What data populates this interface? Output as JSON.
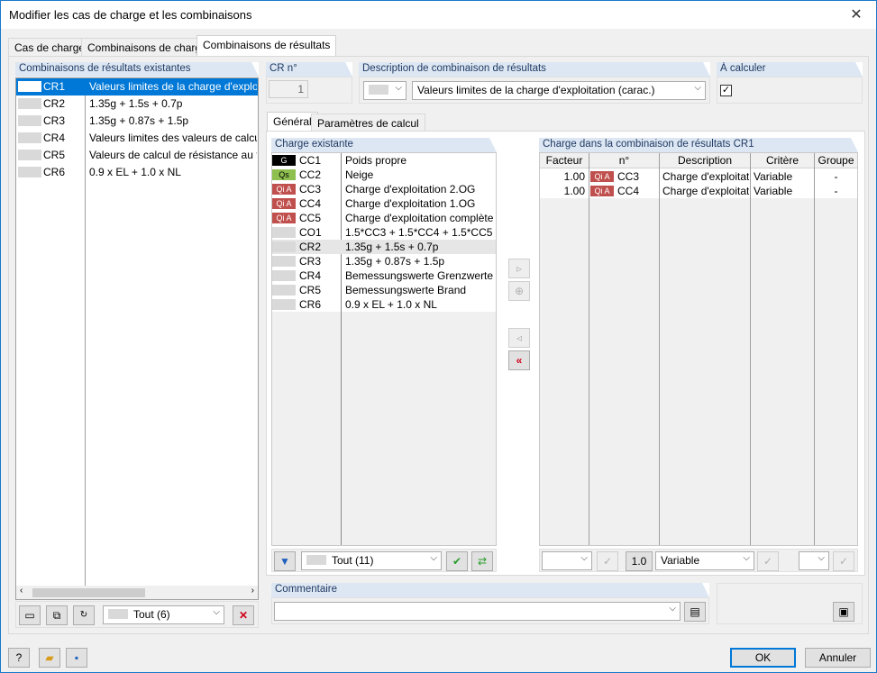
{
  "window": {
    "title": "Modifier les cas de charge et les combinaisons",
    "close_glyph": "✕"
  },
  "tabs": [
    "Cas de charge",
    "Combinaisons de charge",
    "Combinaisons de résultats"
  ],
  "left": {
    "header": "Combinaisons de résultats existantes",
    "items": [
      {
        "code": "CR1",
        "desc": "Valeurs limites de la charge d'exploitation (carac.)",
        "selected": true
      },
      {
        "code": "CR2",
        "desc": "1.35g + 1.5s + 0.7p"
      },
      {
        "code": "CR3",
        "desc": "1.35g + 0.87s + 1.5p"
      },
      {
        "code": "CR4",
        "desc": "Valeurs limites des valeurs de calcul"
      },
      {
        "code": "CR5",
        "desc": "Valeurs de calcul de résistance au feu"
      },
      {
        "code": "CR6",
        "desc": "0.9 x EL + 1.0 x NL"
      }
    ],
    "filter": "Tout (6)"
  },
  "cr_no": {
    "label": "CR n°",
    "value": "1"
  },
  "description": {
    "label": "Description de combinaison de résultats",
    "value": "Valeurs limites de la charge d'exploitation (carac.)"
  },
  "to_calculate": {
    "label": "À calculer",
    "checked": "✓"
  },
  "subtabs": [
    "Général",
    "Paramètres de calcul"
  ],
  "existing": {
    "header": "Charge existante",
    "items": [
      {
        "badge": "G",
        "type": "g",
        "code": "CC1",
        "desc": "Poids propre"
      },
      {
        "badge": "Qs",
        "type": "qs",
        "code": "CC2",
        "desc": "Neige"
      },
      {
        "badge": "Qi A",
        "type": "qi",
        "code": "CC3",
        "desc": "Charge d'exploitation 2.OG"
      },
      {
        "badge": "Qi A",
        "type": "qi",
        "code": "CC4",
        "desc": "Charge d'exploitation 1.OG"
      },
      {
        "badge": "Qi A",
        "type": "qi",
        "code": "CC5",
        "desc": "Charge d'exploitation complète"
      },
      {
        "badge": "",
        "type": "none",
        "code": "CO1",
        "desc": "1.5*CC3 + 1.5*CC4 + 1.5*CC5"
      },
      {
        "badge": "",
        "type": "none",
        "code": "CR2",
        "desc": "1.35g + 1.5s + 0.7p",
        "highlight": true
      },
      {
        "badge": "",
        "type": "none",
        "code": "CR3",
        "desc": "1.35g + 0.87s + 1.5p"
      },
      {
        "badge": "",
        "type": "none",
        "code": "CR4",
        "desc": "Bemessungswerte Grenzwerte"
      },
      {
        "badge": "",
        "type": "none",
        "code": "CR5",
        "desc": "Bemessungswerte Brand"
      },
      {
        "badge": "",
        "type": "none",
        "code": "CR6",
        "desc": "0.9 x EL + 1.0 x NL"
      }
    ],
    "filter": "Tout (11)"
  },
  "combo": {
    "header": "Charge dans la combinaison de résultats CR1",
    "columns": [
      "Facteur",
      "n°",
      "Description",
      "Critère",
      "Groupe"
    ],
    "rows": [
      {
        "factor": "1.00",
        "badge": "Qi A",
        "code": "CC3",
        "desc": "Charge d'exploitati",
        "crit": "Variable",
        "group": "-"
      },
      {
        "factor": "1.00",
        "badge": "Qi A",
        "code": "CC4",
        "desc": "Charge d'exploitati",
        "crit": "Variable",
        "group": "-"
      }
    ],
    "factor_value": "1.0",
    "criterion_value": "Variable"
  },
  "comment": {
    "label": "Commentaire",
    "value": ""
  },
  "buttons": {
    "ok": "OK",
    "cancel": "Annuler"
  },
  "colors": {
    "accent": "#0078d7",
    "qi": "#c0504d",
    "qs": "#8fbf4f",
    "g": "#000000"
  }
}
